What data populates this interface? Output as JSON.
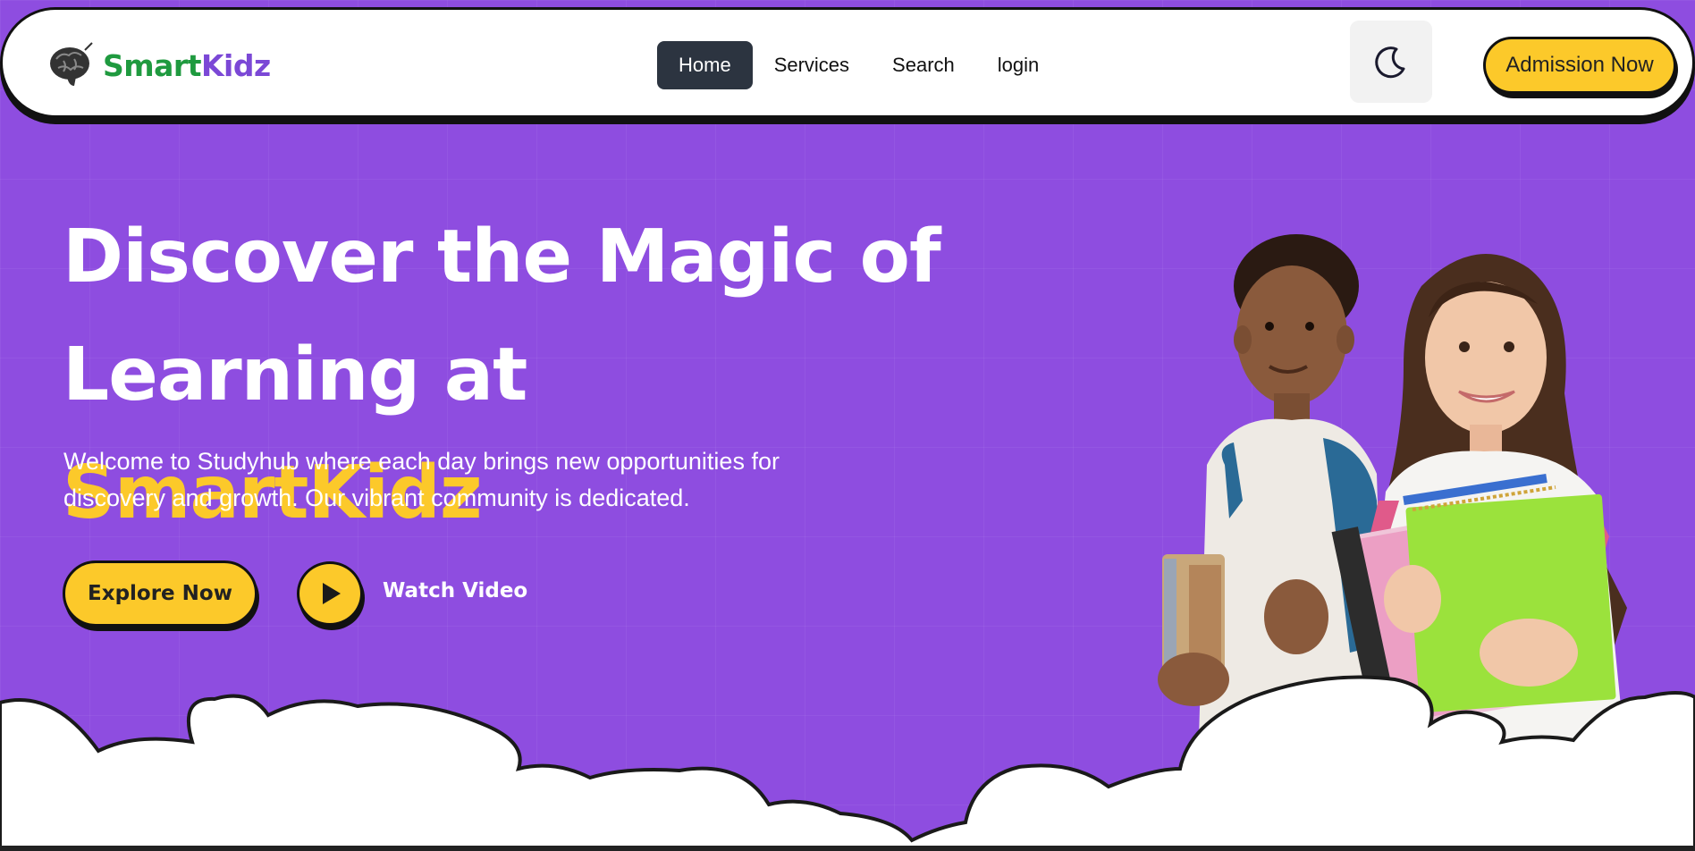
{
  "brand": {
    "name_part1": "Smart",
    "name_part2": "Kidz",
    "icon": "brain-icon"
  },
  "nav": {
    "items": [
      {
        "label": "Home",
        "active": true
      },
      {
        "label": "Services",
        "active": false
      },
      {
        "label": "Search",
        "active": false
      },
      {
        "label": "login",
        "active": false
      }
    ],
    "theme_toggle_icon": "moon-icon",
    "cta_label": "Admission Now"
  },
  "hero": {
    "title_line1": "Discover the Magic of",
    "title_line2_prefix": "Learning at ",
    "title_brand": "SmartKidz",
    "description_line1": "Welcome to Studyhub where each day brings new opportunities for",
    "description_line2": "discovery and growth. Our vibrant community is dedicated.",
    "explore_label": "Explore Now",
    "watch_label": "Watch Video",
    "play_icon": "play-icon"
  },
  "colors": {
    "primary": "#8e4de0",
    "accent": "#fcc92a",
    "brand_green": "#1f9a3f",
    "brand_purple": "#7b48d6",
    "nav_active": "#2c3440"
  }
}
